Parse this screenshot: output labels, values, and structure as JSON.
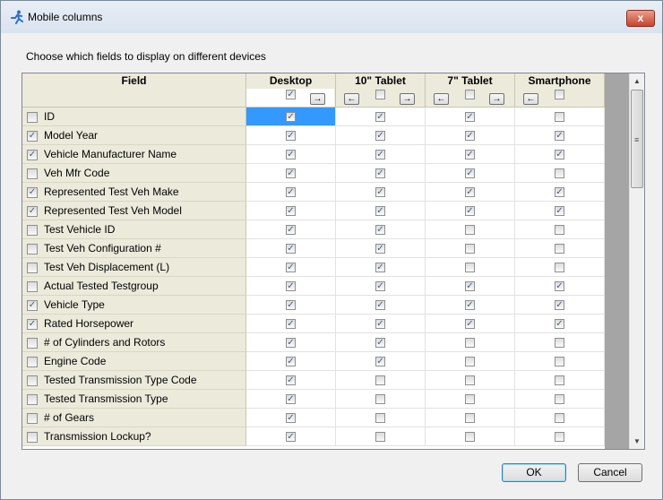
{
  "window": {
    "title": "Mobile columns",
    "close_label": "x"
  },
  "instructions": "Choose which fields to display on different devices",
  "columns": {
    "field": "Field",
    "devices": [
      {
        "label": "Desktop",
        "header_checked": true,
        "left_arrow": false,
        "right_arrow": true,
        "arrow_left_glyph": "",
        "arrow_right_glyph": "→"
      },
      {
        "label": "10\" Tablet",
        "header_checked": false,
        "left_arrow": true,
        "right_arrow": true,
        "arrow_left_glyph": "←",
        "arrow_right_glyph": "→"
      },
      {
        "label": "7\" Tablet",
        "header_checked": false,
        "left_arrow": true,
        "right_arrow": true,
        "arrow_left_glyph": "←",
        "arrow_right_glyph": "→"
      },
      {
        "label": "Smartphone",
        "header_checked": false,
        "left_arrow": true,
        "right_arrow": false,
        "arrow_left_glyph": "←",
        "arrow_right_glyph": ""
      }
    ]
  },
  "rows": [
    {
      "label": "ID",
      "field_checked": false,
      "devices": [
        true,
        true,
        true,
        false
      ],
      "selected_device": 0
    },
    {
      "label": "Model Year",
      "field_checked": true,
      "devices": [
        true,
        true,
        true,
        true
      ]
    },
    {
      "label": "Vehicle Manufacturer Name",
      "field_checked": true,
      "devices": [
        true,
        true,
        true,
        true
      ]
    },
    {
      "label": "Veh Mfr Code",
      "field_checked": false,
      "devices": [
        true,
        true,
        true,
        false
      ]
    },
    {
      "label": "Represented Test Veh Make",
      "field_checked": true,
      "devices": [
        true,
        true,
        true,
        true
      ]
    },
    {
      "label": "Represented Test Veh Model",
      "field_checked": true,
      "devices": [
        true,
        true,
        true,
        true
      ]
    },
    {
      "label": "Test Vehicle ID",
      "field_checked": false,
      "devices": [
        true,
        true,
        false,
        false
      ]
    },
    {
      "label": "Test Veh Configuration #",
      "field_checked": false,
      "devices": [
        true,
        true,
        false,
        false
      ]
    },
    {
      "label": "Test Veh Displacement (L)",
      "field_checked": false,
      "devices": [
        true,
        true,
        false,
        false
      ]
    },
    {
      "label": "Actual Tested Testgroup",
      "field_checked": false,
      "devices": [
        true,
        true,
        true,
        true
      ]
    },
    {
      "label": "Vehicle Type",
      "field_checked": true,
      "devices": [
        true,
        true,
        true,
        true
      ]
    },
    {
      "label": "Rated Horsepower",
      "field_checked": true,
      "devices": [
        true,
        true,
        true,
        true
      ]
    },
    {
      "label": "# of Cylinders and Rotors",
      "field_checked": false,
      "devices": [
        true,
        true,
        false,
        false
      ]
    },
    {
      "label": "Engine Code",
      "field_checked": false,
      "devices": [
        true,
        true,
        false,
        false
      ]
    },
    {
      "label": "Tested Transmission Type Code",
      "field_checked": false,
      "devices": [
        true,
        false,
        false,
        false
      ]
    },
    {
      "label": "Tested Transmission Type",
      "field_checked": false,
      "devices": [
        true,
        false,
        false,
        false
      ]
    },
    {
      "label": "# of Gears",
      "field_checked": false,
      "devices": [
        true,
        false,
        false,
        false
      ]
    },
    {
      "label": "Transmission Lockup?",
      "field_checked": false,
      "devices": [
        true,
        false,
        false,
        false
      ]
    }
  ],
  "buttons": {
    "ok": "OK",
    "cancel": "Cancel"
  },
  "icons": {
    "app": "running-figure-icon",
    "check_glyph": "✓",
    "scroll_up": "▲",
    "scroll_down": "▼",
    "scroll_grip": "≡"
  },
  "colors": {
    "selection": "#3399ff",
    "header_bg": "#eceadb",
    "window_close": "#c8432c"
  }
}
